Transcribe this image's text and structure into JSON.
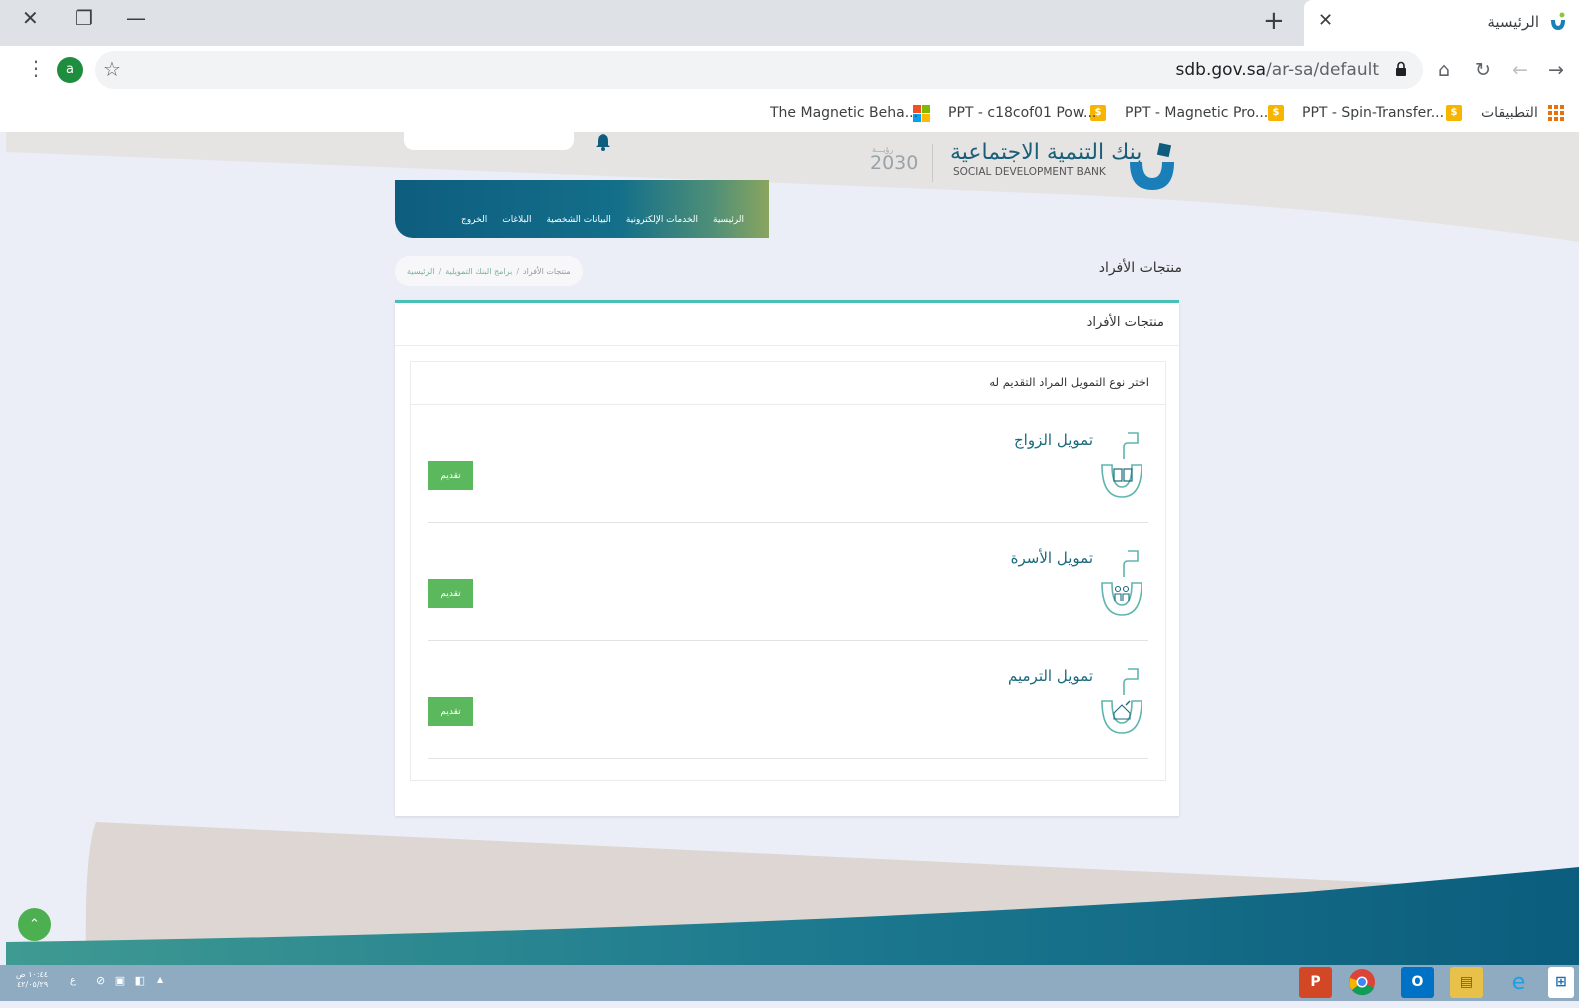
{
  "browser": {
    "tab_title": "الرئيسية",
    "window_controls": {
      "close": "✕",
      "restore": "❐",
      "minimize": "—"
    },
    "new_tab": "+",
    "tab_close": "✕",
    "url_domain": "sdb.gov.sa",
    "url_path": "/ar-sa/default",
    "profile_initial": "a",
    "bookmarks": [
      {
        "label": "التطبيقات",
        "icon": "apps-icon"
      },
      {
        "label": "PPT - Spin-Transfer...",
        "icon": "ppt-icon"
      },
      {
        "label": "PPT - Magnetic Pro...",
        "icon": "ppt-icon"
      },
      {
        "label": "PPT - c18cof01 Pow...",
        "icon": "microsoft-icon"
      },
      {
        "label": "The Magnetic Beha...",
        "icon": "none"
      }
    ]
  },
  "site": {
    "logo_ar": "بنك التنمية الاجتماعية",
    "logo_en": "SOCIAL DEVELOPMENT BANK",
    "vision": "2030",
    "vision_label": "رؤيـــة",
    "nav": [
      "الرئيسية",
      "الخدمات الإلكترونية",
      "البيانات الشخصية",
      "البلاغات",
      "الخروج"
    ],
    "page_title": "منتجات الأفراد",
    "breadcrumb": [
      "الرئيسية",
      "برامج البنك التمويلية",
      "منتجات الأفراد"
    ],
    "breadcrumb_sep": "/",
    "card_title": "منتجات الأفراد",
    "panel_title": "اختر نوع التمويل المراد التقديم له",
    "products": [
      {
        "name": "تمويل الزواج",
        "button": "تقديم",
        "icon": "marriage-loan-icon"
      },
      {
        "name": "تمويل الأسرة",
        "button": "تقديم",
        "icon": "family-loan-icon"
      },
      {
        "name": "تمويل الترميم",
        "button": "تقديم",
        "icon": "renovation-loan-icon"
      }
    ],
    "scroll_top": "⌃"
  },
  "taskbar": {
    "time": "١٠:٤٤ ص",
    "date": "٤٢/٠٥/٢٩",
    "lang": "ع",
    "apps": [
      "powerpoint",
      "chrome",
      "outlook",
      "file-explorer",
      "internet-explorer",
      "start"
    ]
  },
  "colors": {
    "brand_teal": "#0e5d7f",
    "brand_green": "#5cb85c",
    "accent_line": "#48c0b8",
    "page_bg": "#ebeef7"
  }
}
